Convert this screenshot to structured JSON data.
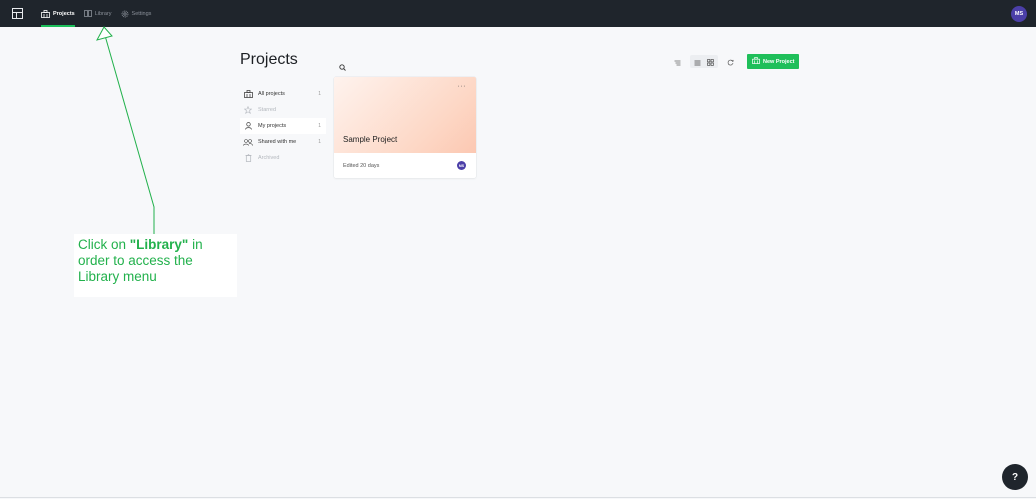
{
  "topbar": {
    "nav": [
      {
        "label": "Projects",
        "icon": "projects-icon",
        "active": true
      },
      {
        "label": "Library",
        "icon": "library-icon",
        "active": false
      },
      {
        "label": "Settings",
        "icon": "gear-icon",
        "active": false
      }
    ],
    "avatar_initials": "MS"
  },
  "header": {
    "title": "Projects",
    "new_project_label": "New Project"
  },
  "sidebar": {
    "items": [
      {
        "label": "All projects",
        "count": "1",
        "icon": "building-icon"
      },
      {
        "label": "Starred",
        "count": "",
        "icon": "star-icon"
      },
      {
        "label": "My projects",
        "count": "1",
        "icon": "user-icon"
      },
      {
        "label": "Shared with me",
        "count": "1",
        "icon": "users-icon"
      },
      {
        "label": "Archived",
        "count": "",
        "icon": "trash-icon"
      }
    ]
  },
  "project_card": {
    "title": "Sample Project",
    "menu": "···",
    "edited": "Edited 20 days",
    "avatar_initials": "MS"
  },
  "annotation": {
    "prefix": "Click on ",
    "emphasis": "\"Library\"",
    "suffix": " in order to access the Library menu"
  },
  "help": {
    "label": "?"
  },
  "colors": {
    "topbar": "#1f252c",
    "accent_green": "#1fbf5a",
    "avatar": "#4b3fa8",
    "annotation": "#22b14c"
  }
}
